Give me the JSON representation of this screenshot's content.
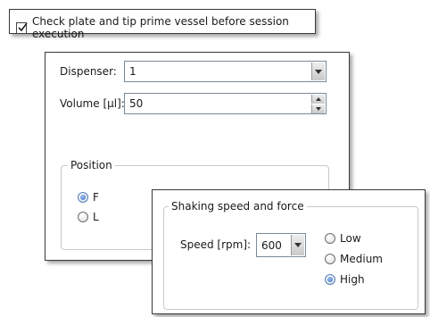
{
  "prime_check": {
    "label": "Check plate and tip prime vessel before session execution",
    "checked": true
  },
  "dispenser_panel": {
    "dispenser": {
      "label": "Dispenser:",
      "value": "1"
    },
    "volume": {
      "label": "Volume [µl]:",
      "value": "50"
    },
    "position": {
      "title": "Position",
      "options": [
        {
          "label": "F",
          "selected": true
        },
        {
          "label": "L",
          "selected": false
        }
      ]
    }
  },
  "shaking_panel": {
    "title": "Shaking speed and force",
    "speed": {
      "label": "Speed [rpm]:",
      "value": "600"
    },
    "force_options": [
      {
        "label": "Low",
        "selected": false
      },
      {
        "label": "Medium",
        "selected": false
      },
      {
        "label": "High",
        "selected": true
      }
    ]
  },
  "colors": {
    "radio_selected": "#3a6fc4",
    "panel_border": "#3a3a3a"
  }
}
